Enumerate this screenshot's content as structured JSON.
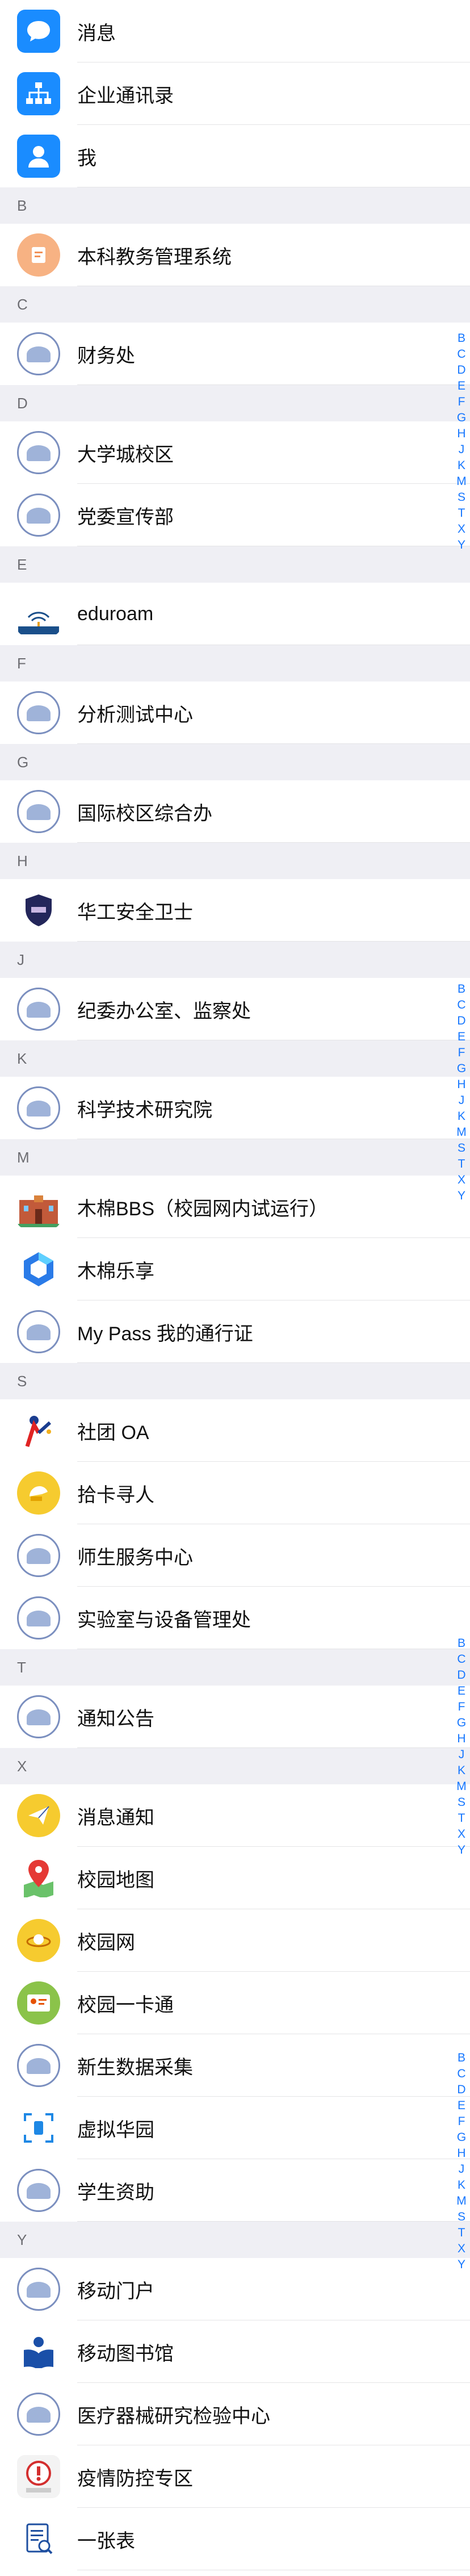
{
  "sections": [
    {
      "letter": "",
      "items": [
        {
          "label": "消息",
          "icon": "chat-bubble-icon"
        },
        {
          "label": "企业通讯录",
          "icon": "org-chart-icon"
        },
        {
          "label": "我",
          "icon": "person-icon"
        }
      ]
    },
    {
      "letter": "B",
      "items": [
        {
          "label": "本科教务管理系统",
          "icon": "academic-system-icon"
        }
      ]
    },
    {
      "letter": "C",
      "items": [
        {
          "label": "财务处",
          "icon": "university-seal-icon"
        }
      ]
    },
    {
      "letter": "D",
      "items": [
        {
          "label": "大学城校区",
          "icon": "university-seal-icon"
        },
        {
          "label": "党委宣传部",
          "icon": "university-seal-icon"
        }
      ]
    },
    {
      "letter": "E",
      "items": [
        {
          "label": "eduroam",
          "icon": "eduroam-logo-icon"
        }
      ]
    },
    {
      "letter": "F",
      "items": [
        {
          "label": "分析测试中心",
          "icon": "university-seal-icon"
        }
      ]
    },
    {
      "letter": "G",
      "items": [
        {
          "label": "国际校区综合办",
          "icon": "university-seal-icon"
        }
      ]
    },
    {
      "letter": "H",
      "items": [
        {
          "label": "华工安全卫士",
          "icon": "security-shield-icon"
        }
      ]
    },
    {
      "letter": "J",
      "items": [
        {
          "label": "纪委办公室、监察处",
          "icon": "university-seal-icon"
        }
      ]
    },
    {
      "letter": "K",
      "items": [
        {
          "label": "科学技术研究院",
          "icon": "university-seal-icon"
        }
      ]
    },
    {
      "letter": "M",
      "items": [
        {
          "label": "木棉BBS（校园网内试运行）",
          "icon": "bbs-building-icon"
        },
        {
          "label": "木棉乐享",
          "icon": "hexagon-share-icon"
        },
        {
          "label": "My Pass 我的通行证",
          "icon": "university-seal-icon"
        }
      ]
    },
    {
      "letter": "S",
      "items": [
        {
          "label": "社团 OA",
          "icon": "club-oa-icon"
        },
        {
          "label": "拾卡寻人",
          "icon": "found-card-icon"
        },
        {
          "label": "师生服务中心",
          "icon": "university-seal-icon"
        },
        {
          "label": "实验室与设备管理处",
          "icon": "university-seal-icon"
        }
      ]
    },
    {
      "letter": "T",
      "items": [
        {
          "label": "通知公告",
          "icon": "university-seal-icon"
        }
      ]
    },
    {
      "letter": "X",
      "items": [
        {
          "label": "消息通知",
          "icon": "paper-plane-icon"
        },
        {
          "label": "校园地图",
          "icon": "map-pin-icon"
        },
        {
          "label": "校园网",
          "icon": "campus-network-icon"
        },
        {
          "label": "校园一卡通",
          "icon": "id-card-icon"
        },
        {
          "label": "新生数据采集",
          "icon": "university-seal-icon"
        },
        {
          "label": "虚拟华园",
          "icon": "scan-frame-icon"
        },
        {
          "label": "学生资助",
          "icon": "university-seal-icon"
        }
      ]
    },
    {
      "letter": "Y",
      "items": [
        {
          "label": "移动门户",
          "icon": "university-seal-icon"
        },
        {
          "label": "移动图书馆",
          "icon": "library-book-icon"
        },
        {
          "label": "医疗器械研究检验中心",
          "icon": "university-seal-icon"
        },
        {
          "label": "疫情防控专区",
          "icon": "epidemic-alert-icon"
        },
        {
          "label": "一张表",
          "icon": "form-document-icon"
        }
      ]
    }
  ],
  "index_letters": [
    "B",
    "C",
    "D",
    "E",
    "F",
    "G",
    "H",
    "J",
    "K",
    "M",
    "S",
    "T",
    "X",
    "Y"
  ],
  "colors": {
    "accent": "#1677ff",
    "header_bg": "#efeff4"
  }
}
